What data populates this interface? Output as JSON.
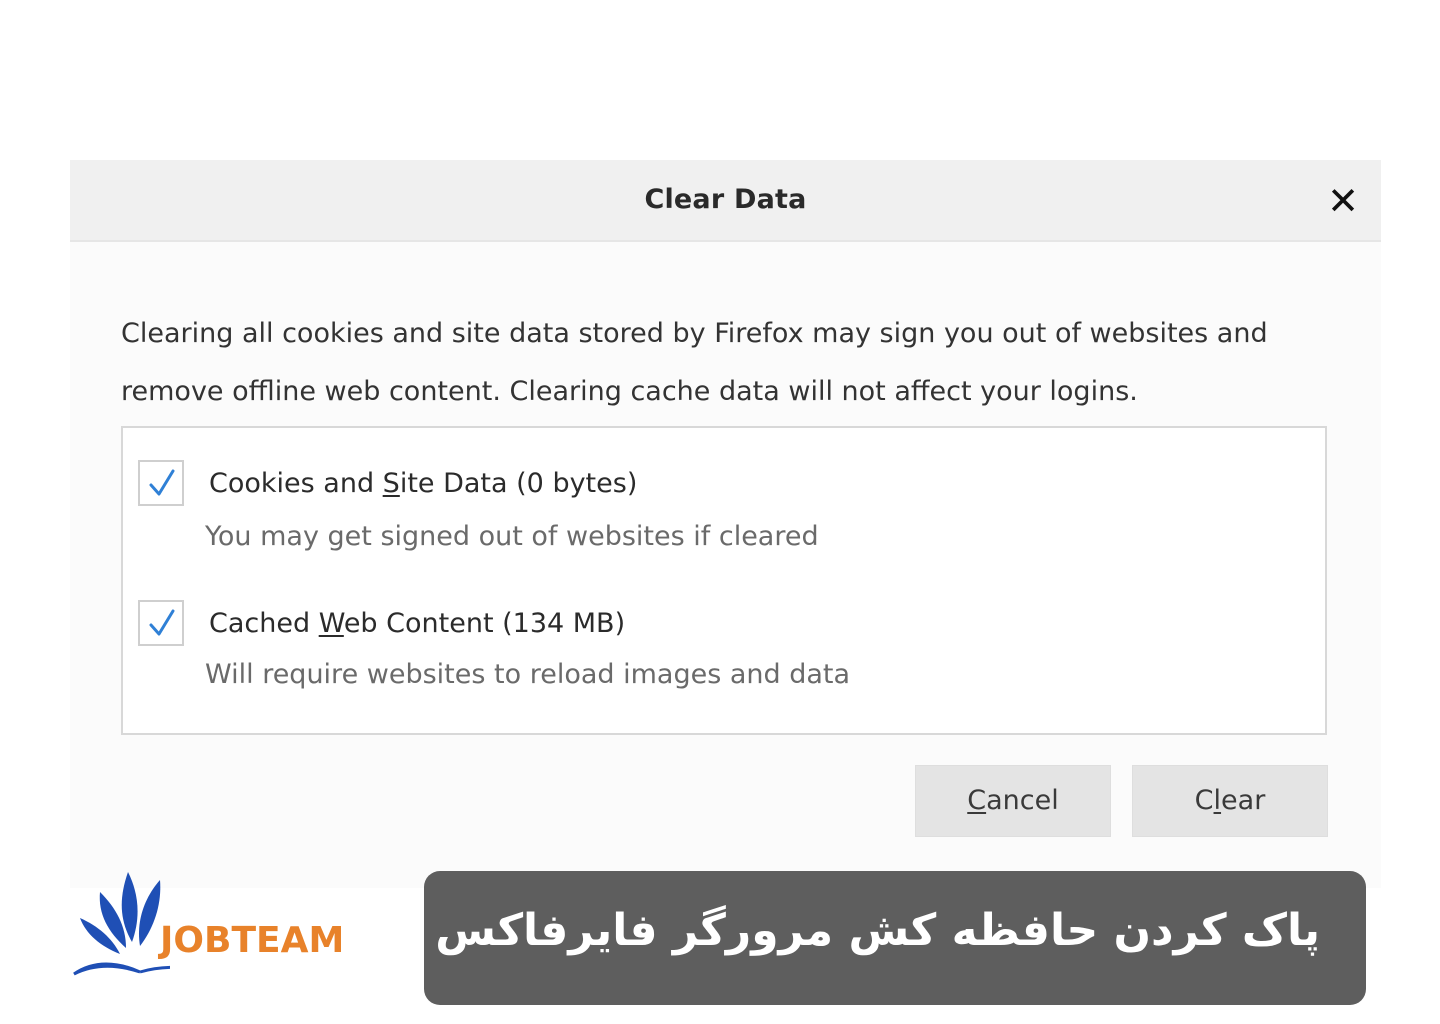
{
  "dialog": {
    "title": "Clear Data",
    "close_glyph": "✕",
    "description_line1": "Clearing all cookies and site data stored by Firefox may sign you out of websites and",
    "description_line2": "remove offline web content. Clearing cache data will not affect your logins.",
    "options": [
      {
        "checked": true,
        "label_pre": "Cookies and ",
        "label_accel": "S",
        "label_post": "ite Data (0 bytes)",
        "sub": "You may get signed out of websites if cleared"
      },
      {
        "checked": true,
        "label_pre": "Cached ",
        "label_accel": "W",
        "label_post": "eb Content (134 MB)",
        "sub": "Will require websites to reload images and data"
      }
    ],
    "cancel_accel": "C",
    "cancel_rest": "ancel",
    "clear_pre": "C",
    "clear_accel": "l",
    "clear_post": "ear"
  },
  "logo": {
    "text": "JOBTEAM"
  },
  "banner": {
    "text": "پاک کردن حافظه کش مرورگر فایرفاکس"
  },
  "colors": {
    "checkmark": "#2f80d6",
    "logo_orange": "#e8822a",
    "logo_blue": "#1f4fb5",
    "banner_bg": "#5e5e5e"
  }
}
